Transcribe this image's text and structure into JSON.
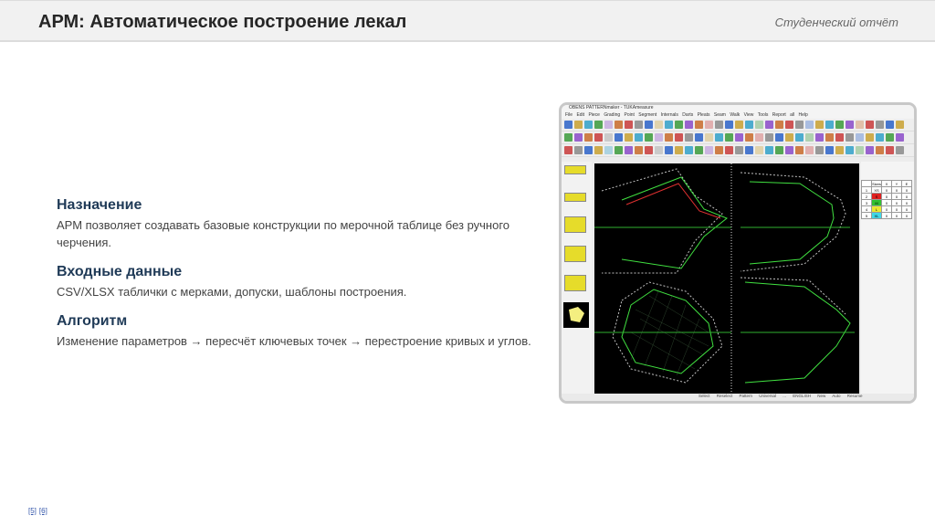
{
  "header": {
    "title": "АРМ: Автоматическое построение лекал",
    "subtitle": "Студенческий отчёт"
  },
  "sections": [
    {
      "heading": "Назначение",
      "text": "АРМ позволяет создавать базовые конструкции по мерочной таблице без ручного черчения."
    },
    {
      "heading": "Входные данные",
      "text": "CSV/XLSX таблички с мерками, допуски, шаблоны построения."
    },
    {
      "heading": "Алгоритм",
      "text": "Изменение параметров → пересчёт ключевых точек → перестроение кривых и углов."
    }
  ],
  "references": [
    "[5]",
    "[6]"
  ],
  "screenshot": {
    "window_title": "OBENS PATTERNmaker - TUKAmeasure",
    "menu": "File Edit Piece Grading Point Segment Internals Darts Pleats Seam Walk View Tools Report all Help",
    "size_table": {
      "header": [
        "",
        "Sizes",
        "X",
        "Y",
        "E"
      ],
      "rows": [
        [
          "1",
          "XS",
          "0",
          "0",
          "0"
        ],
        [
          "2",
          "S",
          "0",
          "0",
          "0"
        ],
        [
          "3",
          "M",
          "0",
          "0",
          "0"
        ],
        [
          "4",
          "L",
          "0",
          "0",
          "0"
        ],
        [
          "5",
          "XL",
          "0",
          "0",
          "0"
        ]
      ],
      "row_colors": [
        "#ffffff",
        "#e02020",
        "#30c030",
        "#e8e830",
        "#40d8e8"
      ]
    },
    "status": "Select Reselect Pattern Universal ... ENGLISH New Auto Resume"
  }
}
